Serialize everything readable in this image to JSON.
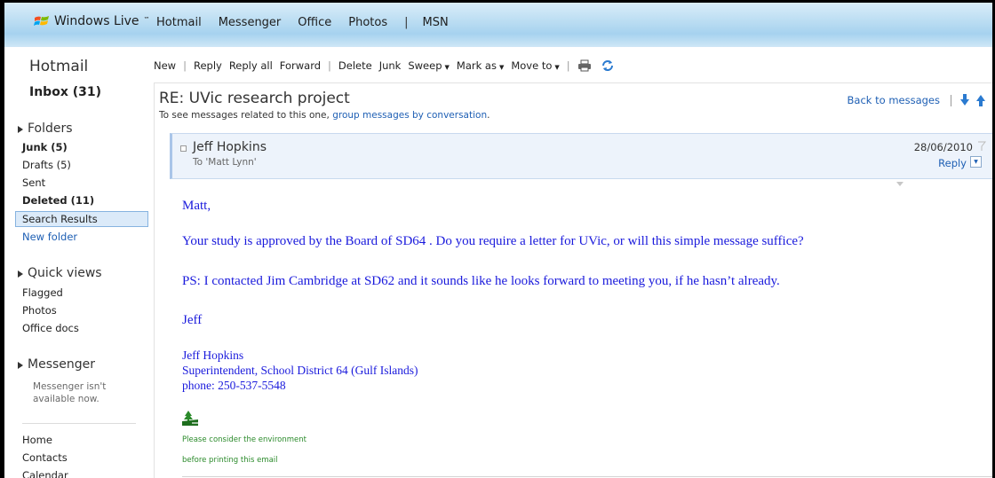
{
  "header": {
    "brand": "Windows Live",
    "brand_tm": "™",
    "nav": [
      "Hotmail",
      "Messenger",
      "Office",
      "Photos",
      "|",
      "MSN"
    ]
  },
  "sidebar": {
    "app_title": "Hotmail",
    "inbox": "Inbox (31)",
    "folders_heading": "Folders",
    "folders": [
      {
        "label": "Junk (5)",
        "bold": true
      },
      {
        "label": "Drafts (5)",
        "bold": false
      },
      {
        "label": "Sent",
        "bold": false
      },
      {
        "label": "Deleted (11)",
        "bold": true
      },
      {
        "label": "Search Results",
        "bold": false,
        "selected": true
      },
      {
        "label": "New folder",
        "link": true
      }
    ],
    "quickviews_heading": "Quick views",
    "quickviews": [
      "Flagged",
      "Photos",
      "Office docs"
    ],
    "messenger_heading": "Messenger",
    "messenger_status": "Messenger isn't available now.",
    "bottom_links": [
      "Home",
      "Contacts",
      "Calendar"
    ]
  },
  "toolbar": {
    "new": "New",
    "reply": "Reply",
    "reply_all": "Reply all",
    "forward": "Forward",
    "delete": "Delete",
    "junk": "Junk",
    "sweep": "Sweep",
    "mark_as": "Mark as",
    "move_to": "Move to",
    "print_icon": "printer-icon",
    "refresh_icon": "refresh-icon"
  },
  "message": {
    "subject": "RE: UVic research project",
    "related_prefix": "To see messages related to this one, ",
    "related_link": "group messages by conversation",
    "related_suffix": ".",
    "back": "Back to messages",
    "sender": "Jeff Hopkins",
    "to": "To 'Matt Lynn'",
    "date": "28/06/2010",
    "reply": "Reply",
    "body": [
      "Matt,",
      "Your study is approved by the Board of SD64 . Do you require a letter for UVic, or will this simple message suffice?",
      "PS: I contacted Jim Cambridge at SD62 and it sounds like he looks forward to meeting you, if he hasn’t already.",
      "Jeff"
    ],
    "signature": [
      "Jeff Hopkins",
      "Superintendent, School District 64 (Gulf Islands)",
      "phone: 250-537-5548"
    ],
    "env_line1": "Please consider the environment",
    "env_line2": "before printing this email"
  },
  "colors": {
    "link": "#1e5fb4",
    "body_text": "#1a1adc",
    "env_text": "#2a8a2a",
    "header_bg": "#b9dcf2"
  }
}
